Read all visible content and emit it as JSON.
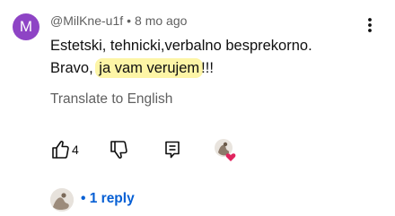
{
  "comment": {
    "avatar_letter": "M",
    "author": "@MilKne-u1f",
    "separator": "•",
    "time": "8 mo ago",
    "text_before": "Estetski, tehnicki,verbalno besprekorno.",
    "text_bravo": "Bravo, ",
    "text_highlight": "ja vam verujem",
    "text_after": "!!!",
    "translate_label": "Translate to English",
    "like_count": "4",
    "replies_label": "• 1 reply"
  },
  "colors": {
    "avatar_bg": "#8e44c5",
    "highlight": "#fdf5a6",
    "link": "#065fd4",
    "heart": "#e0245e"
  },
  "icons": [
    "more-vert-icon",
    "thumb-up-icon",
    "thumb-down-icon",
    "reply-icon",
    "heart-icon"
  ]
}
